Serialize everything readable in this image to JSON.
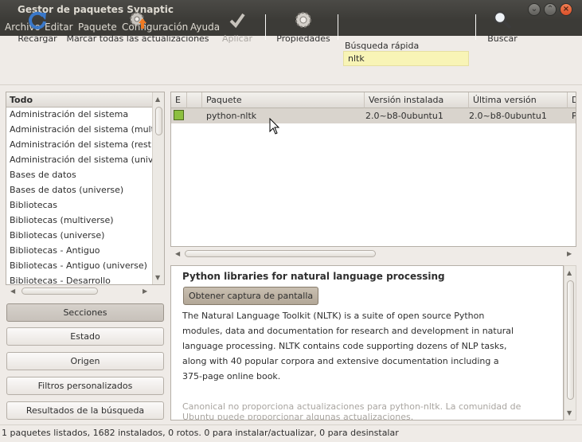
{
  "window": {
    "title": "Gestor de paquetes Synaptic"
  },
  "menu": [
    "Archivo",
    "Editar",
    "Paquete",
    "Configuración",
    "Ayuda"
  ],
  "toolbar": {
    "reload_label": "Recargar",
    "mark_all_label": "Marcar todas las actualizaciones",
    "apply_label": "Aplicar",
    "properties_label": "Propiedades",
    "quick_search_label": "Búsqueda rápida",
    "quick_search_value": "nltk",
    "search_label": "Buscar"
  },
  "sections": {
    "header": "Todo",
    "items": [
      "Administración del sistema",
      "Administración del sistema (multiverse)",
      "Administración del sistema (restricted)",
      "Administración del sistema (universe)",
      "Bases de datos",
      "Bases de datos (universe)",
      "Bibliotecas",
      "Bibliotecas (multiverse)",
      "Bibliotecas (universe)",
      "Bibliotecas - Antiguo",
      "Bibliotecas - Antiguo (universe)",
      "Bibliotecas - Desarrollo"
    ]
  },
  "filter_buttons": {
    "sections": "Secciones",
    "status": "Estado",
    "origin": "Origen",
    "custom": "Filtros personalizados",
    "results": "Resultados de la búsqueda"
  },
  "packages": {
    "columns": {
      "status": "E",
      "name": "Paquete",
      "installed": "Versión instalada",
      "latest": "Última versión",
      "description": "D"
    },
    "rows": [
      {
        "name": "python-nltk",
        "installed": "2.0~b8-0ubuntu1",
        "latest": "2.0~b8-0ubuntu1",
        "description": "P"
      }
    ]
  },
  "description": {
    "title": "Python libraries for natural language processing",
    "screenshot_button": "Obtener captura de pantalla",
    "lines": [
      "The Natural Language Toolkit (NLTK) is a suite of open source Python",
      "modules, data and documentation for research and development in natural",
      "language processing. NLTK contains code supporting dozens of NLP tasks,",
      "along with 40 popular corpora and extensive documentation including a",
      "375-page online book."
    ],
    "support_lines": [
      "Canonical no proporciona actualizaciones para python-nltk. La comunidad de",
      "Ubuntu puede proporcionar algunas actualizaciones."
    ]
  },
  "status": {
    "text": "1 paquetes listados, 1682 instalados, 0 rotos. 0 para instalar/actualizar, 0 para desinstalar"
  }
}
